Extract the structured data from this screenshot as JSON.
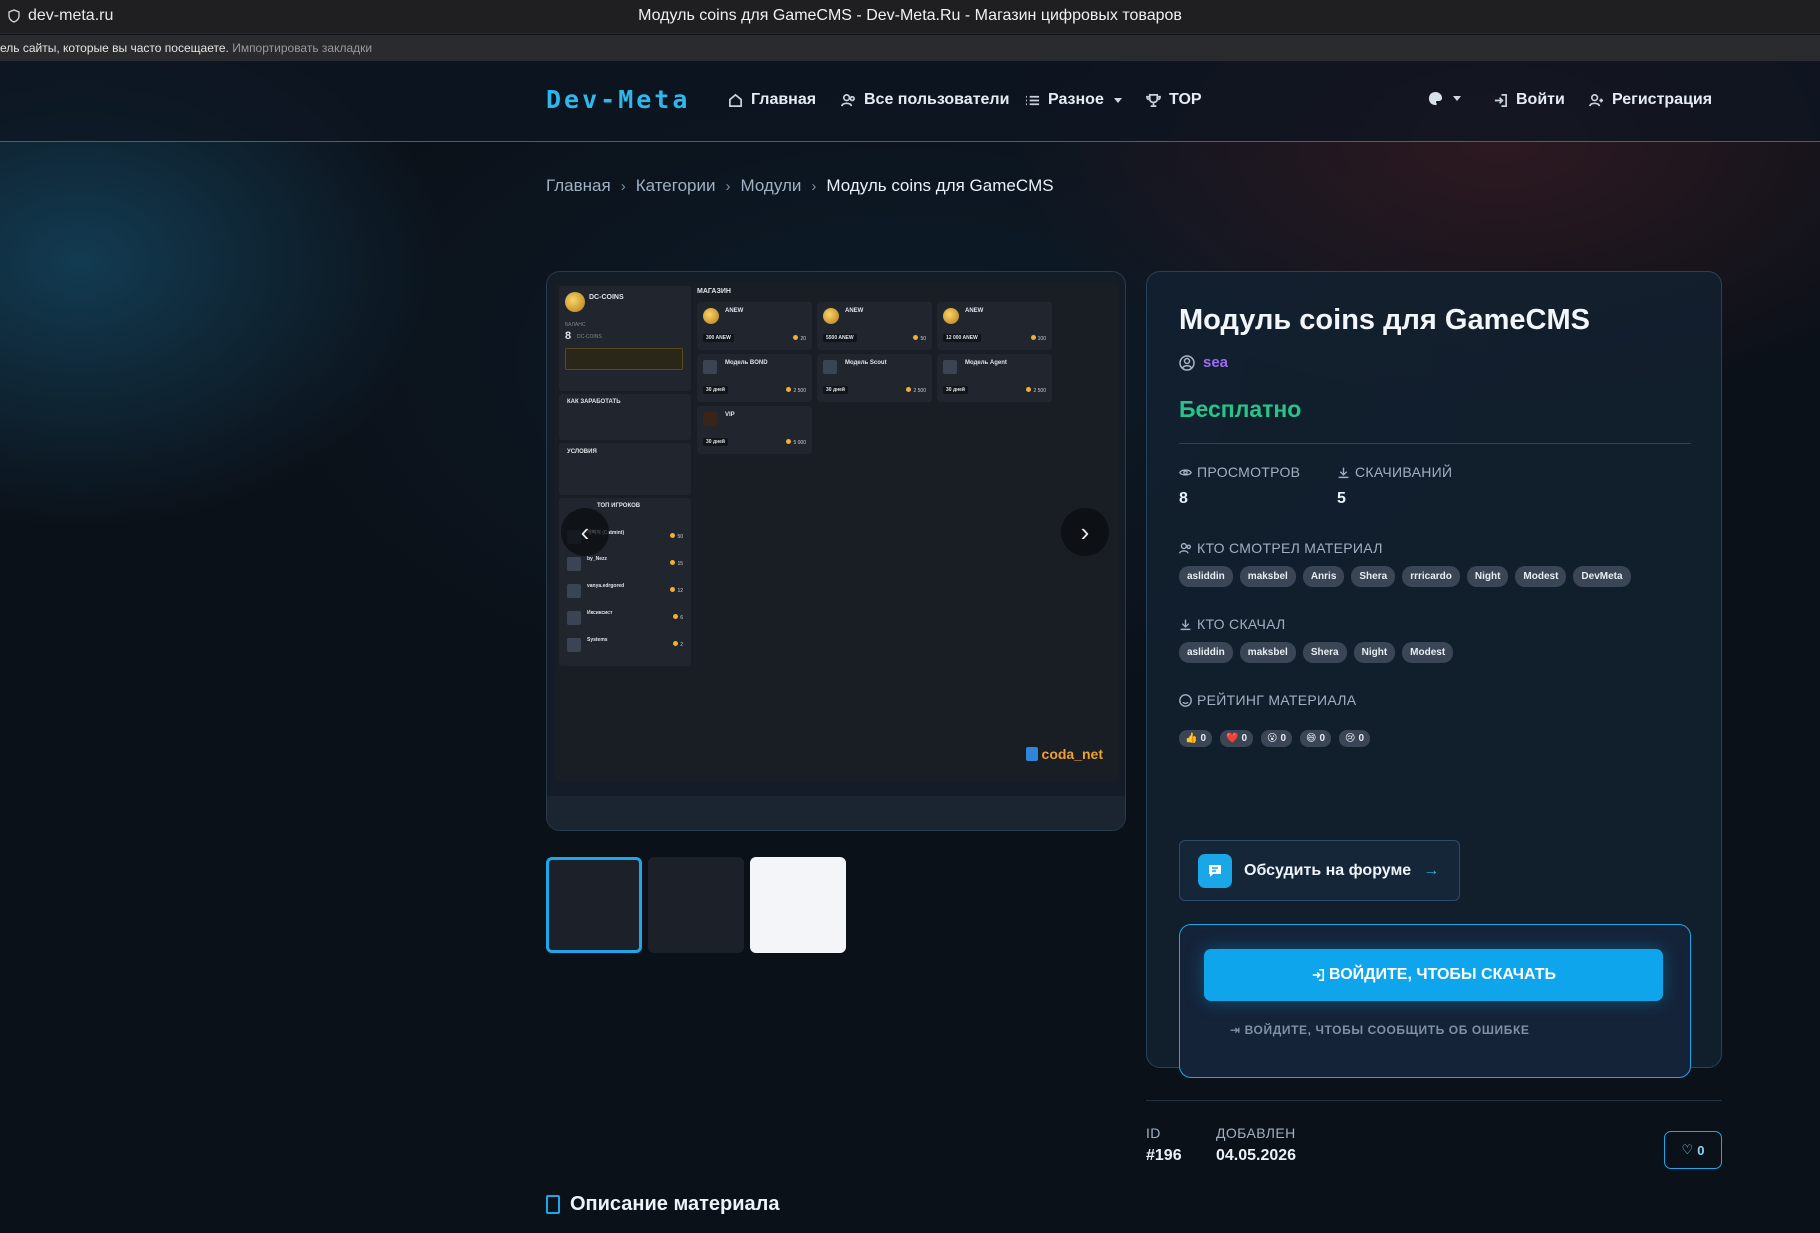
{
  "browser": {
    "url": "dev-meta.ru",
    "title": "Модуль coins для GameCMS - Dev-Meta.Ru - Магазин цифровых товаров",
    "bookmarks_text": "ель сайты, которые вы часто посещаете.",
    "bookmarks_link": "Импортировать закладки"
  },
  "nav": {
    "logo": "Dev-Meta",
    "home": "Главная",
    "users": "Все пользователи",
    "misc": "Разное",
    "top": "TOP",
    "login": "Войти",
    "register": "Регистрация"
  },
  "breadcrumb": [
    "Главная",
    "Категории",
    "Модули",
    "Модуль coins для GameCMS"
  ],
  "gallery": {
    "watermark": "coda_net",
    "shot": {
      "coins_title": "DC-COINS",
      "balance_label": "БАЛАНС",
      "balance": "8",
      "balance_unit": "DC-COINS",
      "shop_title": "МАГАЗИН",
      "earn_title": "КАК ЗАРАБОТАТЬ",
      "terms_title": "УСЛОВИЯ",
      "top_title": "ТОП ИГРОКОВ",
      "items": [
        {
          "name": "ANEW",
          "tag": "300 ANEW",
          "price": "20"
        },
        {
          "name": "ANEW",
          "tag": "5500 ANEW",
          "price": "50"
        },
        {
          "name": "ANEW",
          "tag": "12 000 ANEW",
          "price": "100"
        },
        {
          "name": "Модель BOND",
          "tag": "30 дней",
          "price": "2 500"
        },
        {
          "name": "Модель Scout",
          "tag": "30 дней",
          "price": "2 500"
        },
        {
          "name": "Модель Agent",
          "tag": "30 дней",
          "price": "2 500"
        },
        {
          "name": "VIP",
          "tag": "30 дней",
          "price": "5 000"
        }
      ],
      "players": [
        {
          "name": "개빡쳐 (Catmint)",
          "score": "50"
        },
        {
          "name": "by_Nezz",
          "score": "15"
        },
        {
          "name": "vanya.edrgored",
          "score": "12"
        },
        {
          "name": "Иксиксист",
          "score": "6"
        },
        {
          "name": "Systems",
          "score": "2"
        }
      ]
    }
  },
  "product": {
    "title": "Модуль coins для GameCMS",
    "author": "sea",
    "price": "Бесплатно",
    "views_label": "ПРОСМОТРОВ",
    "views": "8",
    "downloads_label": "СКАЧИВАНИЙ",
    "downloads": "5",
    "viewers_label": "КТО СМОТРЕЛ МАТЕРИАЛ",
    "viewers": [
      "asliddin",
      "maksbel",
      "Anris",
      "Shera",
      "rrricardo",
      "Night",
      "Modest",
      "DevMeta"
    ],
    "downloaders_label": "КТО СКАЧАЛ",
    "downloaders": [
      "asliddin",
      "maksbel",
      "Shera",
      "Night",
      "Modest"
    ],
    "rating_label": "РЕЙТИНГ МАТЕРИАЛА",
    "reactions": [
      {
        "icon": "👍",
        "count": "0"
      },
      {
        "icon": "❤️",
        "count": "0"
      },
      {
        "icon": "😮",
        "count": "0"
      },
      {
        "icon": "😄",
        "count": "0"
      },
      {
        "icon": "😢",
        "count": "0"
      }
    ],
    "forum_button": "Обсудить на форуме",
    "download_button": "ВОЙДИТЕ, ЧТОБЫ СКАЧАТЬ",
    "report_link": "ВОЙДИТЕ, ЧТОБЫ СООБЩИТЬ ОБ ОШИБКЕ"
  },
  "meta": {
    "id_label": "ID",
    "id": "#196",
    "added_label": "ДОБАВЛЕН",
    "added": "04.05.2026",
    "likes": "0"
  },
  "description_title": "Описание материала",
  "colors": {
    "accent": "#1ea7e8",
    "price": "#27c48a",
    "author": "#9b6df0"
  }
}
